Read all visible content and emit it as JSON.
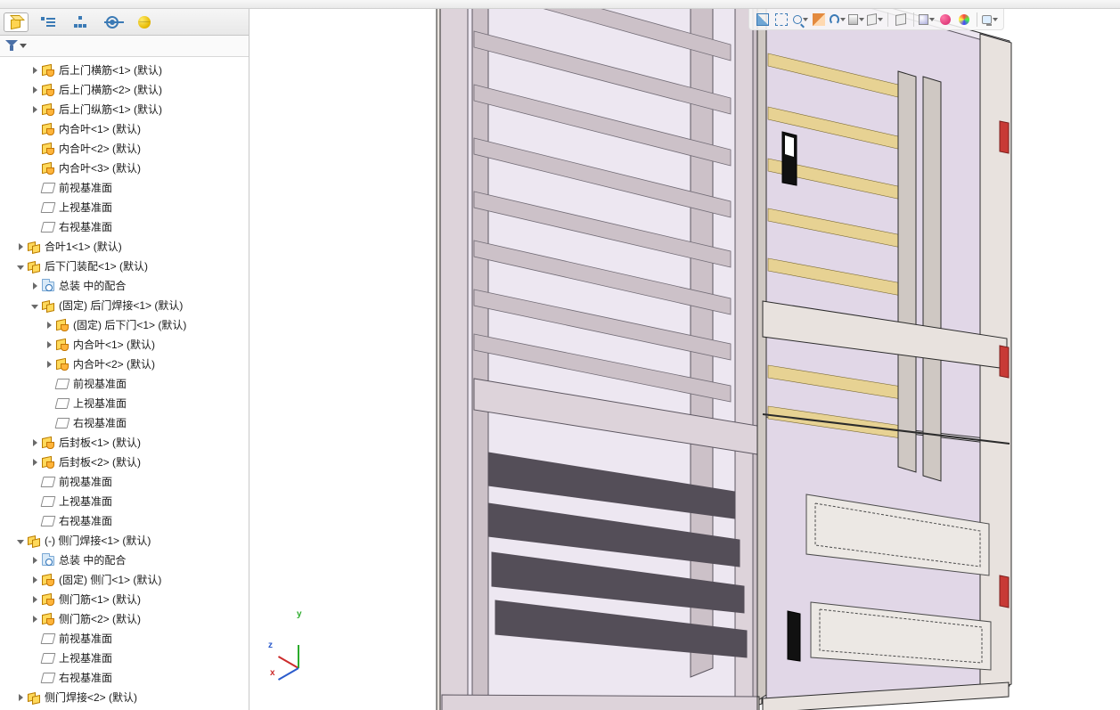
{
  "panel_tabs": {
    "assembly": "assembly-tab",
    "feature_manager": "feature-manager-tab",
    "configuration": "configuration-tab",
    "display": "display-tab",
    "appearance": "appearance-tab"
  },
  "tree": [
    {
      "depth": 2,
      "expander": "closed",
      "icon": "part-hand",
      "label": "后上门横筋<1> (默认)"
    },
    {
      "depth": 2,
      "expander": "closed",
      "icon": "part-hand",
      "label": "后上门横筋<2> (默认)"
    },
    {
      "depth": 2,
      "expander": "closed",
      "icon": "part-hand",
      "label": "后上门纵筋<1> (默认)"
    },
    {
      "depth": 2,
      "expander": "none",
      "icon": "part-hand",
      "label": "内合叶<1> (默认)"
    },
    {
      "depth": 2,
      "expander": "none",
      "icon": "part-hand",
      "label": "内合叶<2> (默认)"
    },
    {
      "depth": 2,
      "expander": "none",
      "icon": "part-hand",
      "label": "内合叶<3> (默认)"
    },
    {
      "depth": 2,
      "expander": "none",
      "icon": "plane",
      "label": "前视基准面"
    },
    {
      "depth": 2,
      "expander": "none",
      "icon": "plane",
      "label": "上视基准面"
    },
    {
      "depth": 2,
      "expander": "none",
      "icon": "plane",
      "label": "右视基准面"
    },
    {
      "depth": 1,
      "expander": "closed",
      "icon": "assembly",
      "label": "合叶1<1> (默认)"
    },
    {
      "depth": 1,
      "expander": "open",
      "icon": "assembly",
      "label": "后下门装配<1> (默认)"
    },
    {
      "depth": 2,
      "expander": "closed",
      "icon": "mates",
      "label": "总装 中的配合"
    },
    {
      "depth": 2,
      "expander": "open",
      "icon": "assembly",
      "label": "(固定) 后门焊接<1> (默认)"
    },
    {
      "depth": 3,
      "expander": "closed",
      "icon": "part-hand",
      "label": "(固定) 后下门<1> (默认)"
    },
    {
      "depth": 3,
      "expander": "closed",
      "icon": "part-hand",
      "label": "内合叶<1> (默认)"
    },
    {
      "depth": 3,
      "expander": "closed",
      "icon": "part-hand",
      "label": "内合叶<2> (默认)"
    },
    {
      "depth": 3,
      "expander": "none",
      "icon": "plane",
      "label": "前视基准面"
    },
    {
      "depth": 3,
      "expander": "none",
      "icon": "plane",
      "label": "上视基准面"
    },
    {
      "depth": 3,
      "expander": "none",
      "icon": "plane",
      "label": "右视基准面"
    },
    {
      "depth": 2,
      "expander": "closed",
      "icon": "part-hand",
      "label": "后封板<1> (默认)"
    },
    {
      "depth": 2,
      "expander": "closed",
      "icon": "part-hand",
      "label": "后封板<2> (默认)"
    },
    {
      "depth": 2,
      "expander": "none",
      "icon": "plane",
      "label": "前视基准面"
    },
    {
      "depth": 2,
      "expander": "none",
      "icon": "plane",
      "label": "上视基准面"
    },
    {
      "depth": 2,
      "expander": "none",
      "icon": "plane",
      "label": "右视基准面"
    },
    {
      "depth": 1,
      "expander": "open",
      "icon": "assembly",
      "label": "(-) 侧门焊接<1> (默认)"
    },
    {
      "depth": 2,
      "expander": "closed",
      "icon": "mates",
      "label": "总装 中的配合"
    },
    {
      "depth": 2,
      "expander": "closed",
      "icon": "part-hand",
      "label": "(固定) 侧门<1> (默认)"
    },
    {
      "depth": 2,
      "expander": "closed",
      "icon": "part-hand",
      "label": "侧门筋<1> (默认)"
    },
    {
      "depth": 2,
      "expander": "closed",
      "icon": "part-hand",
      "label": "侧门筋<2> (默认)"
    },
    {
      "depth": 2,
      "expander": "none",
      "icon": "plane",
      "label": "前视基准面"
    },
    {
      "depth": 2,
      "expander": "none",
      "icon": "plane",
      "label": "上视基准面"
    },
    {
      "depth": 2,
      "expander": "none",
      "icon": "plane",
      "label": "右视基准面"
    },
    {
      "depth": 1,
      "expander": "closed",
      "icon": "assembly",
      "label": "侧门焊接<2> (默认)"
    }
  ],
  "triad": {
    "x": "x",
    "y": "y",
    "z": "z"
  },
  "hud_icons": [
    "zoom-fit",
    "zoom-area",
    "zoom-previous",
    "section-view",
    "view-orientation",
    "display-style",
    "hide-show",
    "edit-appearance",
    "apply-scene",
    "view-settings",
    "sep",
    "render-tools",
    "sep",
    "appearance-ball",
    "decal",
    "sep",
    "screen-capture"
  ]
}
